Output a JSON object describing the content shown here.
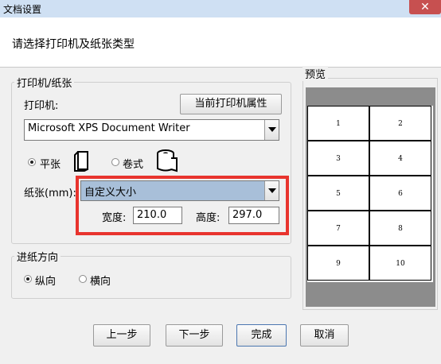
{
  "window": {
    "title": "文档设置",
    "close_glyph": "✕"
  },
  "header": {
    "instruction": "请选择打印机及纸张类型"
  },
  "printer_group": {
    "legend": "打印机/纸张",
    "printer_label": "打印机:",
    "properties_button": "当前打印机属性",
    "printer_select_value": "Microsoft XPS Document Writer",
    "paper_type": {
      "flat_label": "平张",
      "roll_label": "卷式",
      "selected": "平张"
    },
    "paper_label": "纸张(mm):",
    "paper_select_value": "自定义大小",
    "width_label": "宽度:",
    "width_value": "210.0",
    "height_label": "高度:",
    "height_value": "297.0"
  },
  "feed_group": {
    "legend": "进纸方向",
    "portrait_label": "纵向",
    "landscape_label": "横向",
    "selected": "纵向"
  },
  "preview": {
    "legend": "预览",
    "cells": [
      "1",
      "2",
      "3",
      "4",
      "5",
      "6",
      "7",
      "8",
      "9",
      "10"
    ]
  },
  "buttons": {
    "prev": "上一步",
    "next": "下一步",
    "finish": "完成",
    "cancel": "取消"
  },
  "colors": {
    "highlight": "#e8342e",
    "title_bar": "#cfe0f3",
    "close": "#c75050",
    "paper_select_bg": "#a8bfd9"
  }
}
